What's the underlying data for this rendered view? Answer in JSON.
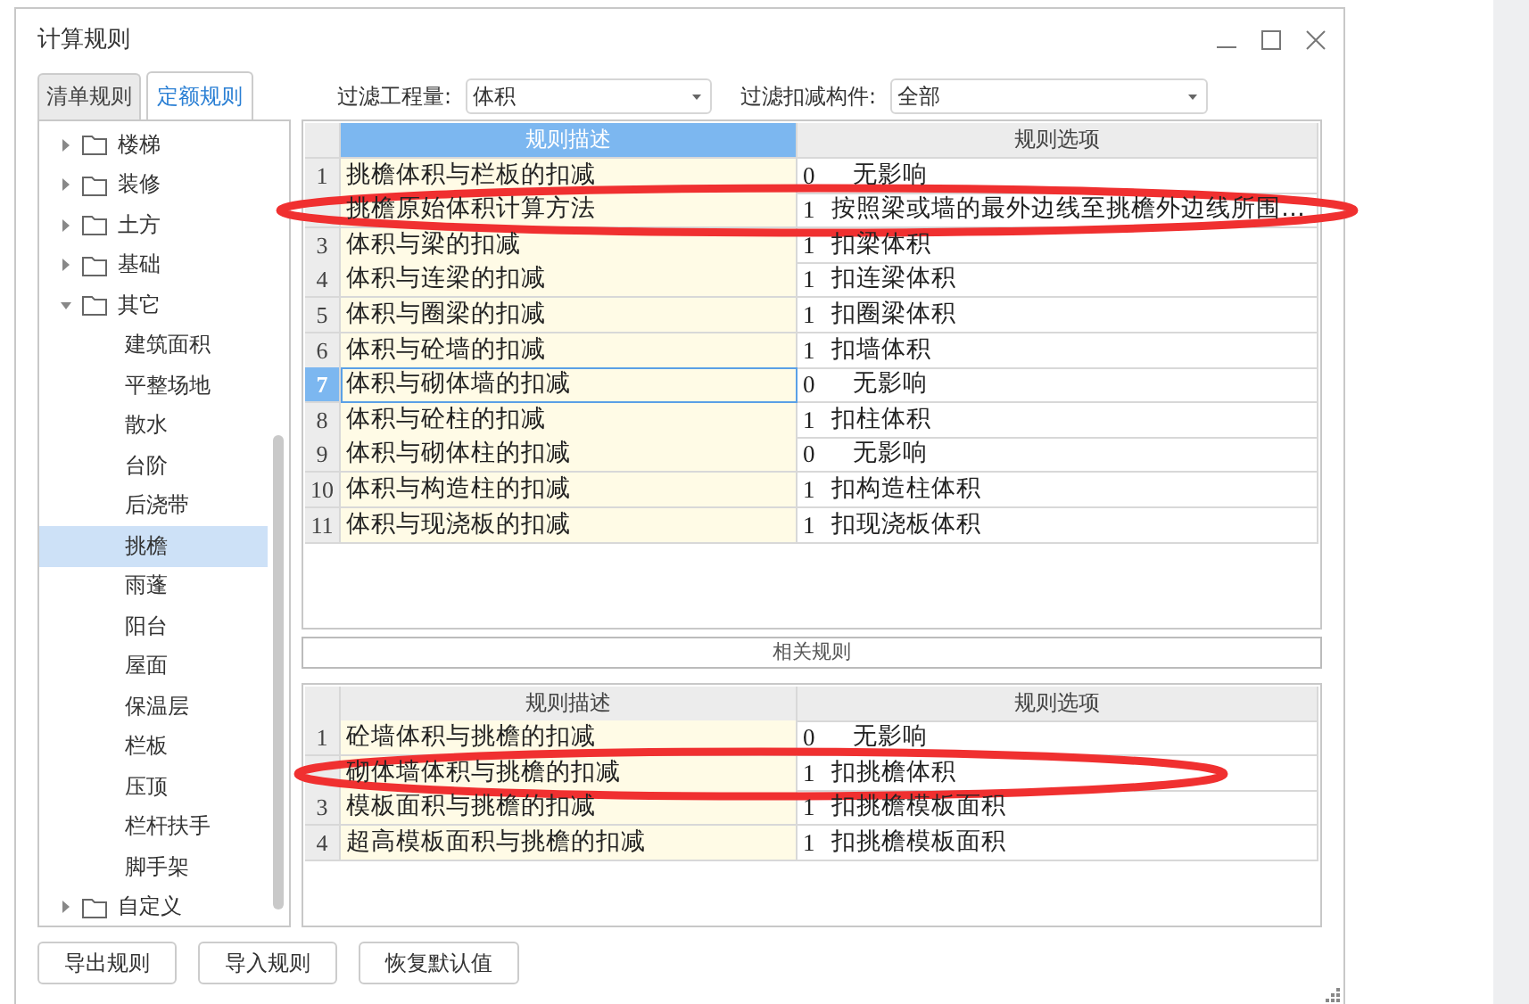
{
  "window": {
    "title": "计算规则"
  },
  "tabs": [
    {
      "label": "清单规则",
      "selected": false
    },
    {
      "label": "定额规则",
      "selected": true
    }
  ],
  "filters": [
    {
      "label": "过滤工程量:",
      "value": "体积"
    },
    {
      "label": "过滤扣减构件:",
      "value": "全部"
    }
  ],
  "tree": [
    {
      "label": "楼梯",
      "expanded": false
    },
    {
      "label": "装修",
      "expanded": false
    },
    {
      "label": "土方",
      "expanded": false
    },
    {
      "label": "基础",
      "expanded": false
    },
    {
      "label": "其它",
      "expanded": true,
      "children": [
        {
          "label": "建筑面积",
          "selected": false
        },
        {
          "label": "平整场地",
          "selected": false
        },
        {
          "label": "散水",
          "selected": false
        },
        {
          "label": "台阶",
          "selected": false
        },
        {
          "label": "后浇带",
          "selected": false
        },
        {
          "label": "挑檐",
          "selected": true
        },
        {
          "label": "雨蓬",
          "selected": false
        },
        {
          "label": "阳台",
          "selected": false
        },
        {
          "label": "屋面",
          "selected": false
        },
        {
          "label": "保温层",
          "selected": false
        },
        {
          "label": "栏板",
          "selected": false
        },
        {
          "label": "压顶",
          "selected": false
        },
        {
          "label": "栏杆扶手",
          "selected": false
        },
        {
          "label": "脚手架",
          "selected": false
        }
      ]
    },
    {
      "label": "自定义",
      "expanded": false
    }
  ],
  "rules_table": {
    "columns": [
      {
        "label": "规则描述",
        "selected": true
      },
      {
        "label": "规则选项",
        "selected": false
      }
    ],
    "rows": [
      {
        "number": "1",
        "description": "挑檐体积与栏板的扣减",
        "code": "0",
        "option": "无影响",
        "selected": false
      },
      {
        "description": "挑檐原始体积计算方法",
        "code": "1",
        "option": "按照梁或墙的最外边线至挑檐外边线所围…",
        "selected": false,
        "circled": true
      },
      {
        "number": "3",
        "description": "体积与梁的扣减",
        "code": "1",
        "option": "扣梁体积",
        "selected": false
      },
      {
        "number": "4",
        "description": "体积与连梁的扣减",
        "code": "1",
        "option": "扣连梁体积",
        "selected": false
      },
      {
        "number": "5",
        "description": "体积与圈梁的扣减",
        "code": "1",
        "option": "扣圈梁体积",
        "selected": false
      },
      {
        "number": "6",
        "description": "体积与砼墙的扣减",
        "code": "1",
        "option": "扣墙体积",
        "selected": false
      },
      {
        "number": "7",
        "description": "体积与砌体墙的扣减",
        "code": "0",
        "option": "无影响",
        "selected": true
      },
      {
        "number": "8",
        "description": "体积与砼柱的扣减",
        "code": "1",
        "option": "扣柱体积",
        "selected": false
      },
      {
        "number": "9",
        "description": "体积与砌体柱的扣减",
        "code": "0",
        "option": "无影响",
        "selected": false
      },
      {
        "number": "10",
        "description": "体积与构造柱的扣减",
        "code": "1",
        "option": "扣构造柱体积",
        "selected": false
      },
      {
        "number": "11",
        "description": "体积与现浇板的扣减",
        "code": "1",
        "option": "扣现浇板体积",
        "selected": false
      }
    ]
  },
  "related_title": "相关规则",
  "related_table": {
    "columns": [
      {
        "label": "规则描述",
        "selected": false
      },
      {
        "label": "规则选项",
        "selected": false
      }
    ],
    "rows": [
      {
        "number": "1",
        "description": "砼墙体积与挑檐的扣减",
        "code": "0",
        "option": "无影响",
        "selected": false
      },
      {
        "description": "砌体墙体积与挑檐的扣减",
        "code": "1",
        "option": "扣挑檐体积",
        "selected": false,
        "circled": true
      },
      {
        "number": "3",
        "description": "模板面积与挑檐的扣减",
        "code": "1",
        "option": "扣挑檐模板面积",
        "selected": false
      },
      {
        "number": "4",
        "description": "超高模板面积与挑檐的扣减",
        "code": "1",
        "option": "扣挑檐模板面积",
        "selected": false
      }
    ]
  },
  "buttons": [
    "导出规则",
    "导入规则",
    "恢复默认值"
  ]
}
